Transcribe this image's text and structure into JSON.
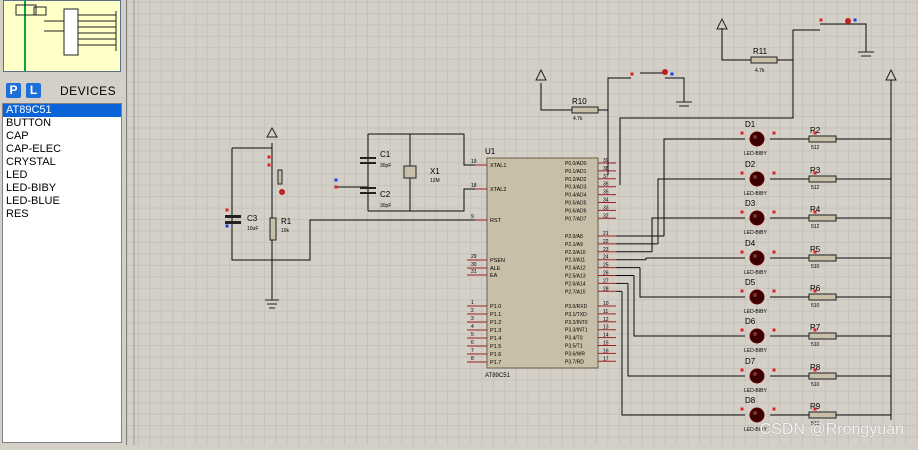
{
  "panel": {
    "p_button": "P",
    "l_button": "L",
    "title": "DEVICES",
    "devices": [
      "AT89C51",
      "BUTTON",
      "CAP",
      "CAP-ELEC",
      "CRYSTAL",
      "LED",
      "LED-BIBY",
      "LED-BLUE",
      "RES"
    ],
    "selected": "AT89C51"
  },
  "schematic": {
    "mcu": {
      "ref": "U1",
      "part": "AT89C51"
    },
    "mcu_left_pins": [
      {
        "num": "19",
        "name": "XTAL1"
      },
      {
        "num": "18",
        "name": "XTAL2"
      },
      {
        "num": "9",
        "name": "RST"
      },
      {
        "num": "29",
        "name": "PSEN"
      },
      {
        "num": "30",
        "name": "ALE"
      },
      {
        "num": "31",
        "name": "EA"
      },
      {
        "num": "1",
        "name": "P1.0"
      },
      {
        "num": "2",
        "name": "P1.1"
      },
      {
        "num": "3",
        "name": "P1.2"
      },
      {
        "num": "4",
        "name": "P1.3"
      },
      {
        "num": "5",
        "name": "P1.4"
      },
      {
        "num": "6",
        "name": "P1.5"
      },
      {
        "num": "7",
        "name": "P1.6"
      },
      {
        "num": "8",
        "name": "P1.7"
      }
    ],
    "mcu_right_pins": [
      {
        "num": "39",
        "name": "P0.0/AD0"
      },
      {
        "num": "38",
        "name": "P0.1/AD1"
      },
      {
        "num": "37",
        "name": "P0.2/AD2"
      },
      {
        "num": "36",
        "name": "P0.3/AD3"
      },
      {
        "num": "35",
        "name": "P0.4/AD4"
      },
      {
        "num": "34",
        "name": "P0.5/AD5"
      },
      {
        "num": "33",
        "name": "P0.6/AD6"
      },
      {
        "num": "32",
        "name": "P0.7/AD7"
      },
      {
        "num": "21",
        "name": "P2.0/A8"
      },
      {
        "num": "22",
        "name": "P2.1/A9"
      },
      {
        "num": "23",
        "name": "P2.2/A10"
      },
      {
        "num": "24",
        "name": "P2.3/A11"
      },
      {
        "num": "25",
        "name": "P2.4/A12"
      },
      {
        "num": "26",
        "name": "P2.5/A13"
      },
      {
        "num": "27",
        "name": "P2.6/A14"
      },
      {
        "num": "28",
        "name": "P2.7/A15"
      },
      {
        "num": "10",
        "name": "P3.0/RXD"
      },
      {
        "num": "11",
        "name": "P3.1/TXD"
      },
      {
        "num": "12",
        "name": "P3.2/INT0"
      },
      {
        "num": "13",
        "name": "P3.3/INT1"
      },
      {
        "num": "14",
        "name": "P3.4/T0"
      },
      {
        "num": "15",
        "name": "P3.5/T1"
      },
      {
        "num": "16",
        "name": "P3.6/WR"
      },
      {
        "num": "17",
        "name": "P3.7/RD"
      }
    ],
    "c1": {
      "ref": "C1",
      "value": "30pF"
    },
    "c2": {
      "ref": "C2",
      "value": "30pF"
    },
    "x1": {
      "ref": "X1",
      "value": "12M"
    },
    "c3": {
      "ref": "C3",
      "value": "10uF"
    },
    "r1": {
      "ref": "R1",
      "value": "10k"
    },
    "r10": {
      "ref": "R10",
      "value": "4.7k"
    },
    "r11": {
      "ref": "R11",
      "value": "4.7k"
    },
    "leds": [
      {
        "ref": "D1",
        "part": "LED-BIBY",
        "r": "R2",
        "rv": "512"
      },
      {
        "ref": "D2",
        "part": "LED-BIBY",
        "r": "R3",
        "rv": "512"
      },
      {
        "ref": "D3",
        "part": "LED-BIBY",
        "r": "R4",
        "rv": "512"
      },
      {
        "ref": "D4",
        "part": "LED-BIBY",
        "r": "R5",
        "rv": "510"
      },
      {
        "ref": "D5",
        "part": "LED-BIBY",
        "r": "R6",
        "rv": "510"
      },
      {
        "ref": "D6",
        "part": "LED-BIBY",
        "r": "R7",
        "rv": "510"
      },
      {
        "ref": "D7",
        "part": "LED-BIBY",
        "r": "R8",
        "rv": "510"
      },
      {
        "ref": "D8",
        "part": "LED-BIBY",
        "r": "R9",
        "rv": "510"
      }
    ]
  },
  "watermark": "CSDN @Rrongyuan"
}
